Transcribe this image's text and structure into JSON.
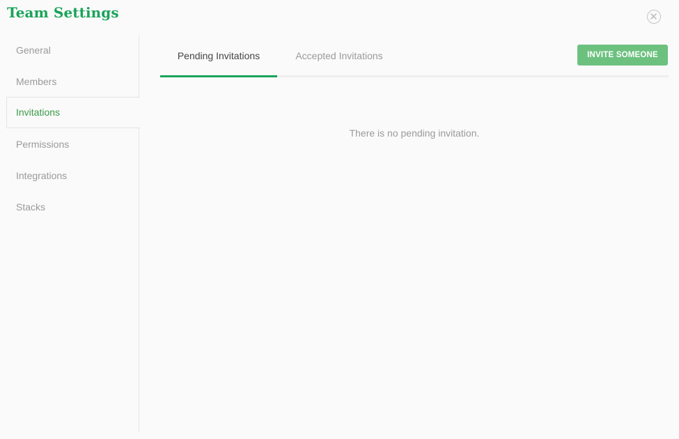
{
  "modal": {
    "title": "Team Settings"
  },
  "sidebar": {
    "items": [
      {
        "label": "General"
      },
      {
        "label": "Members"
      },
      {
        "label": "Invitations"
      },
      {
        "label": "Permissions"
      },
      {
        "label": "Integrations"
      },
      {
        "label": "Stacks"
      }
    ],
    "active": "Invitations"
  },
  "tabs": {
    "items": [
      {
        "label": "Pending Invitations"
      },
      {
        "label": "Accepted Invitations"
      }
    ],
    "active": "Pending Invitations"
  },
  "toolbar": {
    "invite_label": "INVITE SOMEONE"
  },
  "content": {
    "empty_message": "There is no pending invitation."
  },
  "colors": {
    "brand": "#1aa35a",
    "active_nav": "#3a9a48",
    "button": "#6cc17f",
    "muted_text": "#9a9a9a"
  },
  "icons": {
    "close": "close-circle-icon"
  }
}
